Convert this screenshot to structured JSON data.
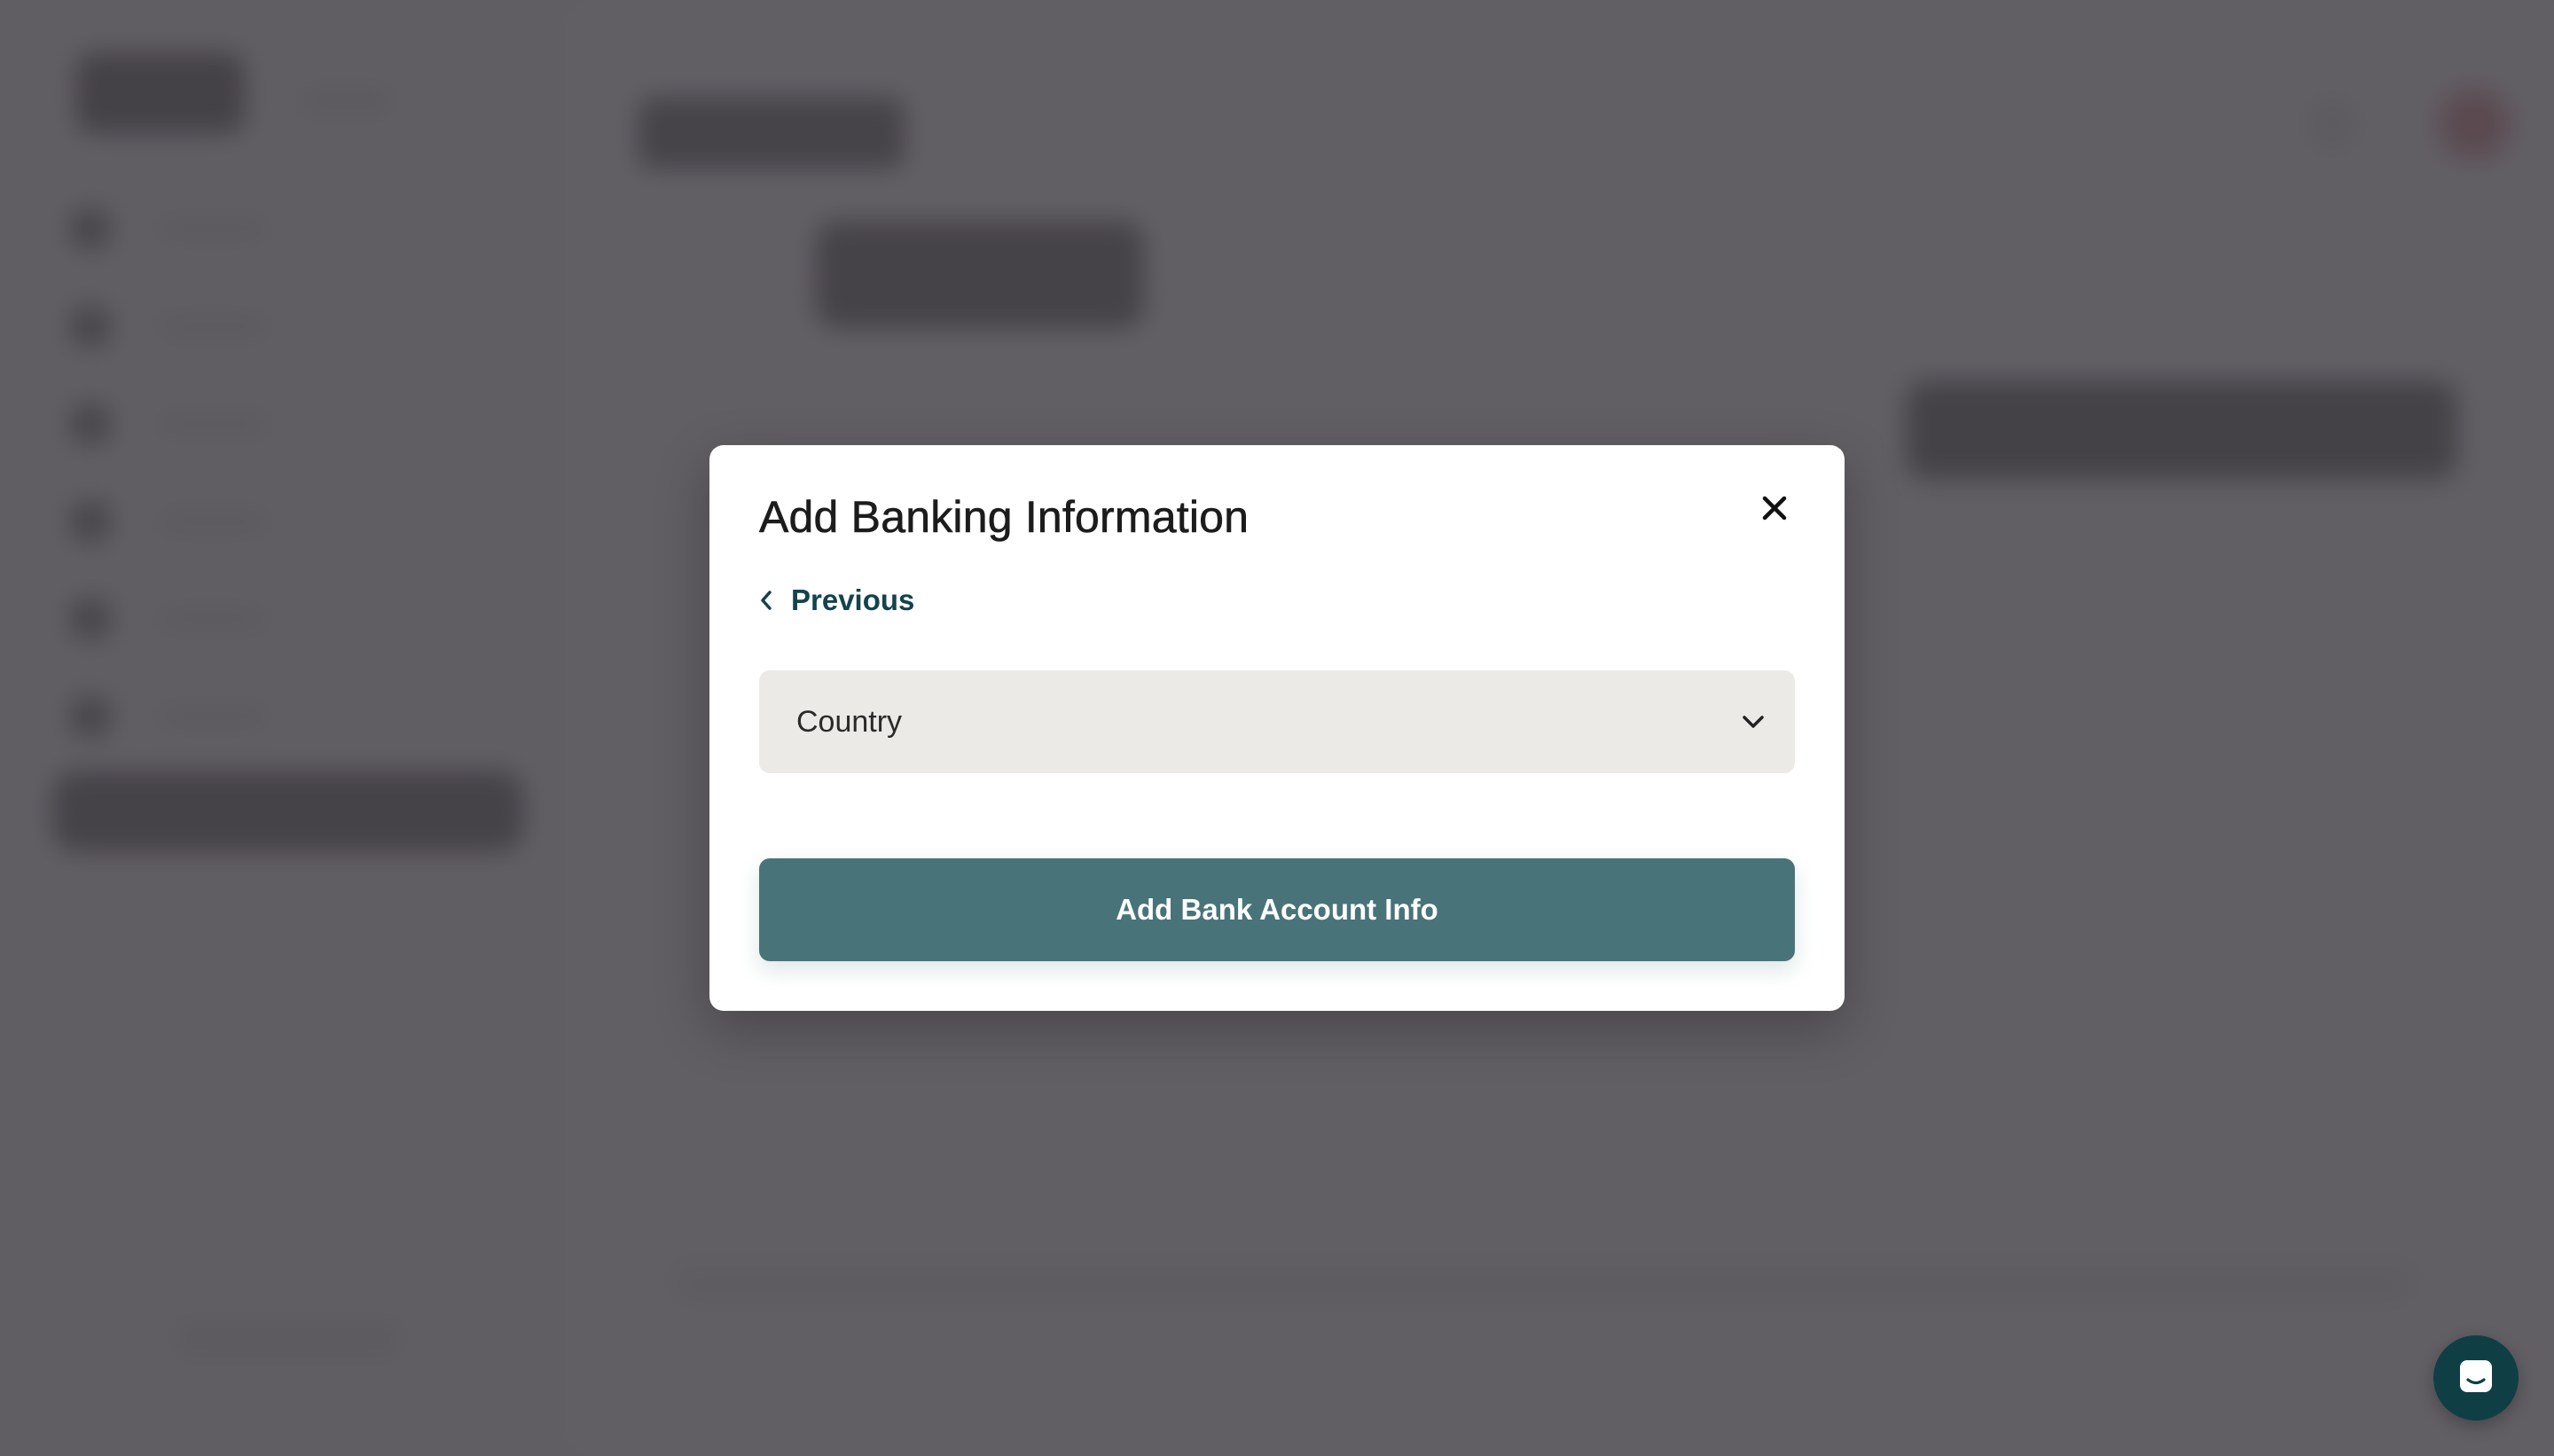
{
  "modal": {
    "title": "Add Banking Information",
    "previous_label": "Previous",
    "country_select": {
      "selected_value": "Country"
    },
    "submit_label": "Add Bank Account Info"
  },
  "icons": {
    "close": "close-icon",
    "previous": "chevron-left-icon",
    "dropdown": "chevron-down-icon",
    "chat": "chat-icon"
  },
  "colors": {
    "primary_button": "#487479",
    "link": "#14434c",
    "chat_launcher": "#0f3f45",
    "select_background": "#ebeae6"
  }
}
